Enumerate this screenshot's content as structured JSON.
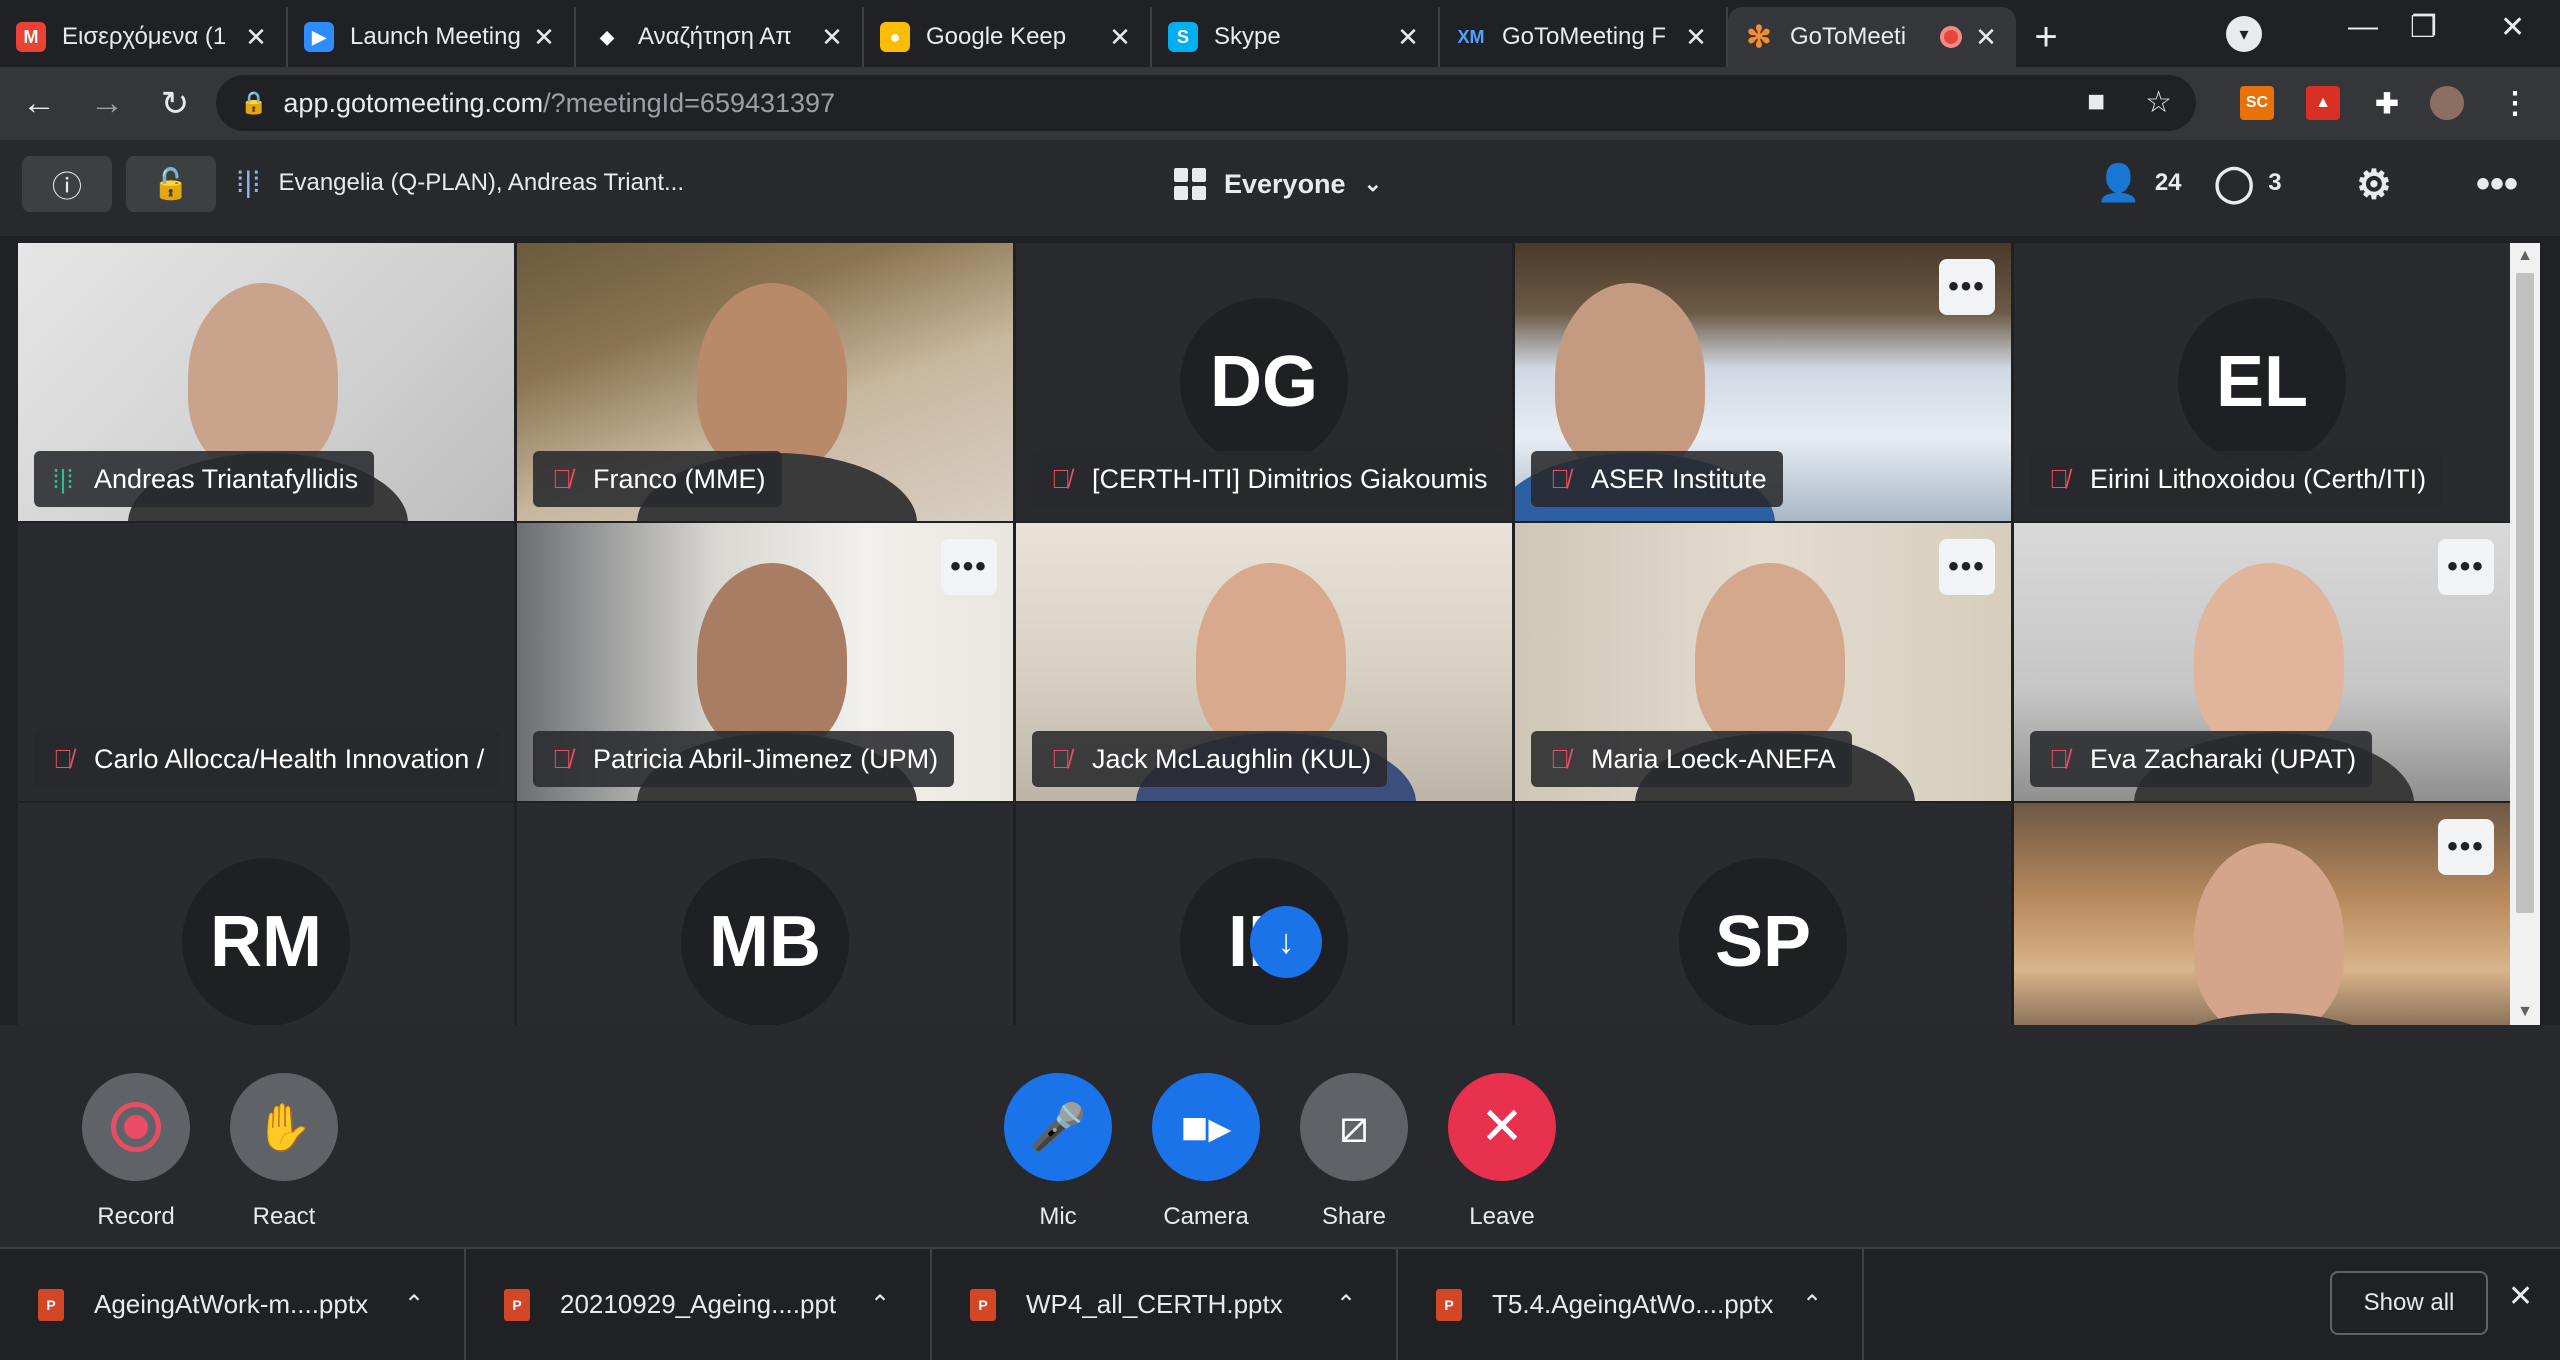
{
  "browser": {
    "tabs": [
      {
        "title": "Εισερχόμενα (1",
        "icon": "gmail-icon",
        "color": "#ea4335",
        "glyph": "M"
      },
      {
        "title": "Launch Meeting",
        "icon": "zoom-icon",
        "color": "#2d8cff",
        "glyph": "▶"
      },
      {
        "title": "Αναζήτηση Απ",
        "icon": "diamond-icon",
        "color": "#ffffff",
        "glyph": "◆"
      },
      {
        "title": "Google Keep",
        "icon": "keep-icon",
        "color": "#fbbc04",
        "glyph": "●"
      },
      {
        "title": "Skype",
        "icon": "skype-icon",
        "color": "#00aff0",
        "glyph": "S"
      },
      {
        "title": "GoToMeeting F",
        "icon": "xm-icon",
        "color": "#0a66c2",
        "glyph": "XM"
      },
      {
        "title": "GoToMeeti",
        "icon": "gotomeeting-icon",
        "color": "#f68d2e",
        "glyph": "✻",
        "active": true
      }
    ],
    "url_host": "app.gotomeeting.com",
    "url_path": "/?meetingId=659431397",
    "ext_sc": "SC"
  },
  "header": {
    "speakers": "Evangelia (Q-PLAN), Andreas Triant...",
    "view": "Everyone",
    "attendee_count": "24",
    "chat_count": "3"
  },
  "tiles": [
    {
      "name": "Andreas Triantafyllidis",
      "mic": "speaking",
      "video": true,
      "selected": true
    },
    {
      "name": "Franco (MME)",
      "mic": "muted",
      "video": true
    },
    {
      "name": "[CERTH-ITI] Dimitrios Giakoumis",
      "mic": "muted",
      "initials": "DG"
    },
    {
      "name": "ASER Institute",
      "mic": "muted",
      "video": true,
      "menu": true
    },
    {
      "name": "Eirini Lithoxoidou (Certh/ITI)",
      "mic": "muted",
      "initials": "EL"
    },
    {
      "name": "Carlo Allocca/Health Innovation /",
      "mic": "muted",
      "blank": true
    },
    {
      "name": "Patricia Abril-Jimenez (UPM)",
      "mic": "muted",
      "video": true,
      "menu": true
    },
    {
      "name": "Jack McLaughlin (KUL)",
      "mic": "muted",
      "video": true
    },
    {
      "name": "Maria Loeck-ANEFA",
      "mic": "muted",
      "video": true,
      "menu": true
    },
    {
      "name": "Eva Zacharaki (UPAT)",
      "mic": "muted",
      "video": true,
      "menu": true
    },
    {
      "initials": "RM"
    },
    {
      "initials": "MB"
    },
    {
      "initials": "IH"
    },
    {
      "initials": "SP"
    },
    {
      "video": true,
      "menu": true
    }
  ],
  "controls": {
    "record": "Record",
    "react": "React",
    "mic": "Mic",
    "camera": "Camera",
    "share": "Share",
    "leave": "Leave"
  },
  "downloads": {
    "items": [
      "AgeingAtWork-m....pptx",
      "20210929_Ageing....ppt",
      "WP4_all_CERTH.pptx",
      "T5.4.AgeingAtWo....pptx"
    ],
    "show_all": "Show all"
  },
  "colors": {
    "mic_muted": "#ea4c65",
    "mic_active": "#24c48e",
    "primary": "#1a73e8",
    "leave": "#e8304f",
    "record_dot": "#ea4c65"
  }
}
